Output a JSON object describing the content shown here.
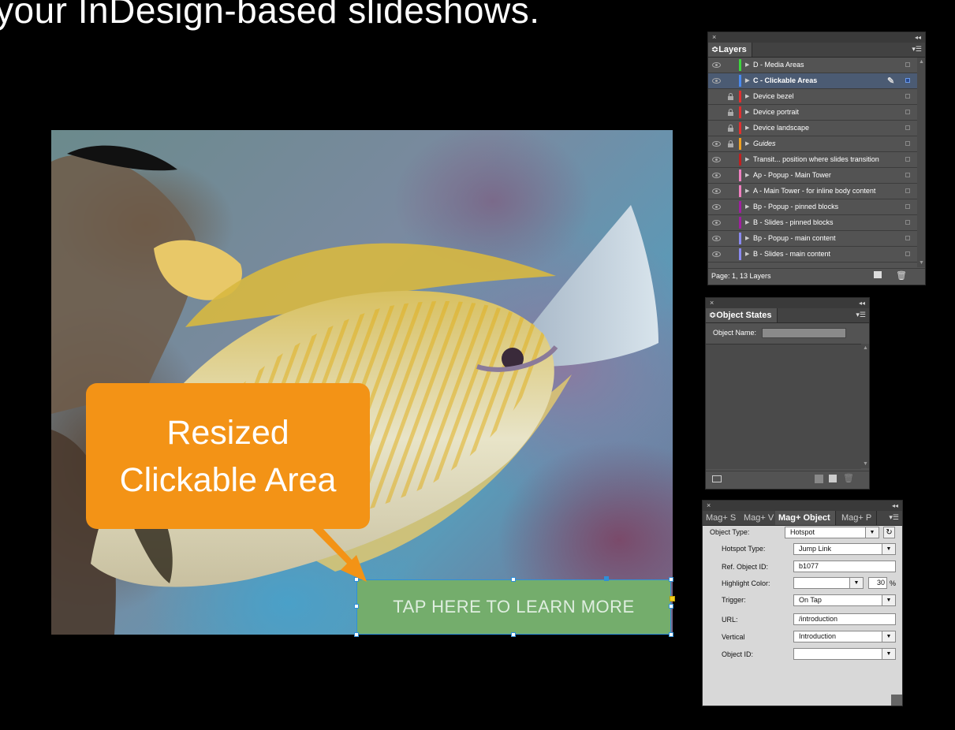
{
  "headline": "your InDesign-based slideshows.",
  "callout": {
    "line1": "Resized",
    "line2": "Clickable Area"
  },
  "hotspot": {
    "label": "TAP HERE TO LEARN MORE"
  },
  "layers_panel": {
    "close": "×",
    "collapse": "◂◂",
    "tab": "≎Layers",
    "menu_icon": "▾☰",
    "rows": [
      {
        "name": "D - Media Areas",
        "color": "#3dd63d",
        "visible": true,
        "locked": false,
        "italic": false
      },
      {
        "name": "C - Clickable Areas",
        "color": "#4a8af0",
        "visible": true,
        "locked": false,
        "italic": false,
        "selected": true
      },
      {
        "name": "Device bezel",
        "color": "#e03030",
        "visible": false,
        "locked": true,
        "italic": false
      },
      {
        "name": "Device portrait",
        "color": "#e03030",
        "visible": false,
        "locked": true,
        "italic": false
      },
      {
        "name": "Device landscape",
        "color": "#e03030",
        "visible": false,
        "locked": true,
        "italic": false
      },
      {
        "name": "Guides",
        "color": "#f0a020",
        "visible": true,
        "locked": true,
        "italic": true
      },
      {
        "name": "Transit... position where slides transition",
        "color": "#c02020",
        "visible": true,
        "locked": false,
        "italic": false
      },
      {
        "name": "Ap - Popup - Main Tower",
        "color": "#f080c0",
        "visible": true,
        "locked": false,
        "italic": false
      },
      {
        "name": "A - Main Tower - for inline body content",
        "color": "#f080c0",
        "visible": true,
        "locked": false,
        "italic": false
      },
      {
        "name": "Bp - Popup - pinned blocks",
        "color": "#a020a0",
        "visible": true,
        "locked": false,
        "italic": false
      },
      {
        "name": "B - Slides - pinned blocks",
        "color": "#a020a0",
        "visible": true,
        "locked": false,
        "italic": false
      },
      {
        "name": "Bp - Popup - main content",
        "color": "#8a8af0",
        "visible": true,
        "locked": false,
        "italic": false
      },
      {
        "name": "B - Slides - main content",
        "color": "#8a8af0",
        "visible": true,
        "locked": false,
        "italic": false
      }
    ],
    "status": "Page: 1, 13 Layers"
  },
  "object_states_panel": {
    "close": "×",
    "collapse": "◂◂",
    "tab": "≎Object States",
    "menu_icon": "▾☰",
    "object_name_label": "Object Name:"
  },
  "magplus_panel": {
    "close": "×",
    "collapse": "◂◂",
    "menu_icon": "▾☰",
    "tabs": [
      "Mag+ S",
      "Mag+ V",
      "Mag+ Object",
      "Mag+ P"
    ],
    "object_type_label": "Object Type:",
    "object_type_value": "Hotspot",
    "hotspot_type_label": "Hotspot Type:",
    "hotspot_type_value": "Jump Link",
    "ref_object_id_label": "Ref. Object ID:",
    "ref_object_id_value": "b1077",
    "highlight_color_label": "Highlight Color:",
    "highlight_percent": "30",
    "percent_sign": "%",
    "trigger_label": "Trigger:",
    "trigger_value": "On Tap",
    "url_label": "URL:",
    "url_value": "/introduction",
    "vertical_label": "Vertical",
    "vertical_value": "Introduction",
    "object_id_label": "Object ID:",
    "object_id_value": ""
  }
}
